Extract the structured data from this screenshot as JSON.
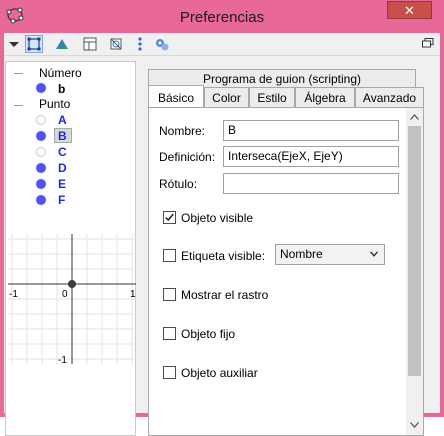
{
  "window": {
    "title": "Preferencias",
    "close_glyph": "✕"
  },
  "toolbar": {
    "icons": [
      "menu-arrow-icon",
      "select-object-icon",
      "layers-icon",
      "layout-icon",
      "graphics-settings-icon",
      "vertical-dots-icon",
      "advanced-settings-icon"
    ],
    "panel_icon": "restore-panel-icon"
  },
  "tree": {
    "groups": [
      {
        "label": "Número",
        "items": [
          {
            "label": "b",
            "visible": true
          }
        ]
      },
      {
        "label": "Punto",
        "items": [
          {
            "label": "A",
            "visible": false
          },
          {
            "label": "B",
            "visible": true,
            "selected": true
          },
          {
            "label": "C",
            "visible": false
          },
          {
            "label": "D",
            "visible": true
          },
          {
            "label": "E",
            "visible": true
          },
          {
            "label": "F",
            "visible": true
          }
        ]
      }
    ]
  },
  "preview": {
    "x_left": "-1",
    "x_zero": "0",
    "x_right": "1",
    "y_bottom": "-1"
  },
  "tabs": {
    "scripting": "Programa de guion (scripting)",
    "items": [
      "Básico",
      "Color",
      "Estilo",
      "Álgebra",
      "Avanzado"
    ],
    "active": "Básico"
  },
  "basic": {
    "name_label": "Nombre:",
    "name_value": "B",
    "definition_label": "Definición:",
    "definition_value": "Interseca(EjeX, EjeY)",
    "caption_label": "Rótulo:",
    "caption_value": "",
    "show_object_label": "Objeto visible",
    "show_object_checked": true,
    "show_label_label": "Etiqueta visible:",
    "show_label_checked": false,
    "label_mode_value": "Nombre",
    "trace_label": "Mostrar el rastro",
    "trace_checked": false,
    "fixed_label": "Objeto fijo",
    "fixed_checked": false,
    "auxiliary_label": "Objeto auxiliar",
    "auxiliary_checked": false
  },
  "colors": {
    "titlebar": "#e9689a",
    "close": "#c7504a",
    "point": "#4c55f2",
    "point_label": "#1f2bd9"
  }
}
